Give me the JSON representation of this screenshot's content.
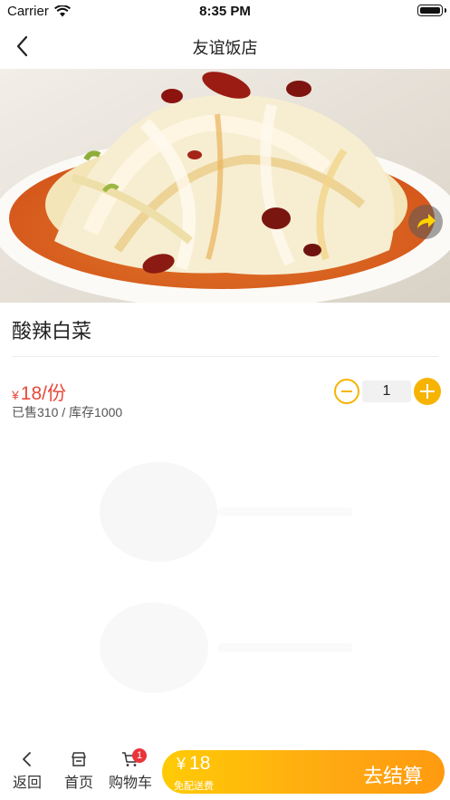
{
  "status_bar": {
    "carrier": "Carrier",
    "time": "8:35 PM"
  },
  "nav": {
    "title": "友谊饭店"
  },
  "product": {
    "name": "酸辣白菜",
    "currency_symbol": "¥",
    "price": "18/份",
    "sales_text": "已售310 / 库存1000",
    "quantity": "1"
  },
  "tabs": {
    "back": "返回",
    "home": "首页",
    "cart": "购物车",
    "cart_badge": "1"
  },
  "checkout": {
    "currency_symbol": "¥",
    "total": "18",
    "delivery_note": "免配送费",
    "label": "去结算"
  },
  "colors": {
    "accent": "#f6b400",
    "price": "#e84a3b",
    "badge": "#e8353b",
    "checkout_start": "#ffcb05",
    "checkout_end": "#ff9a0f"
  }
}
